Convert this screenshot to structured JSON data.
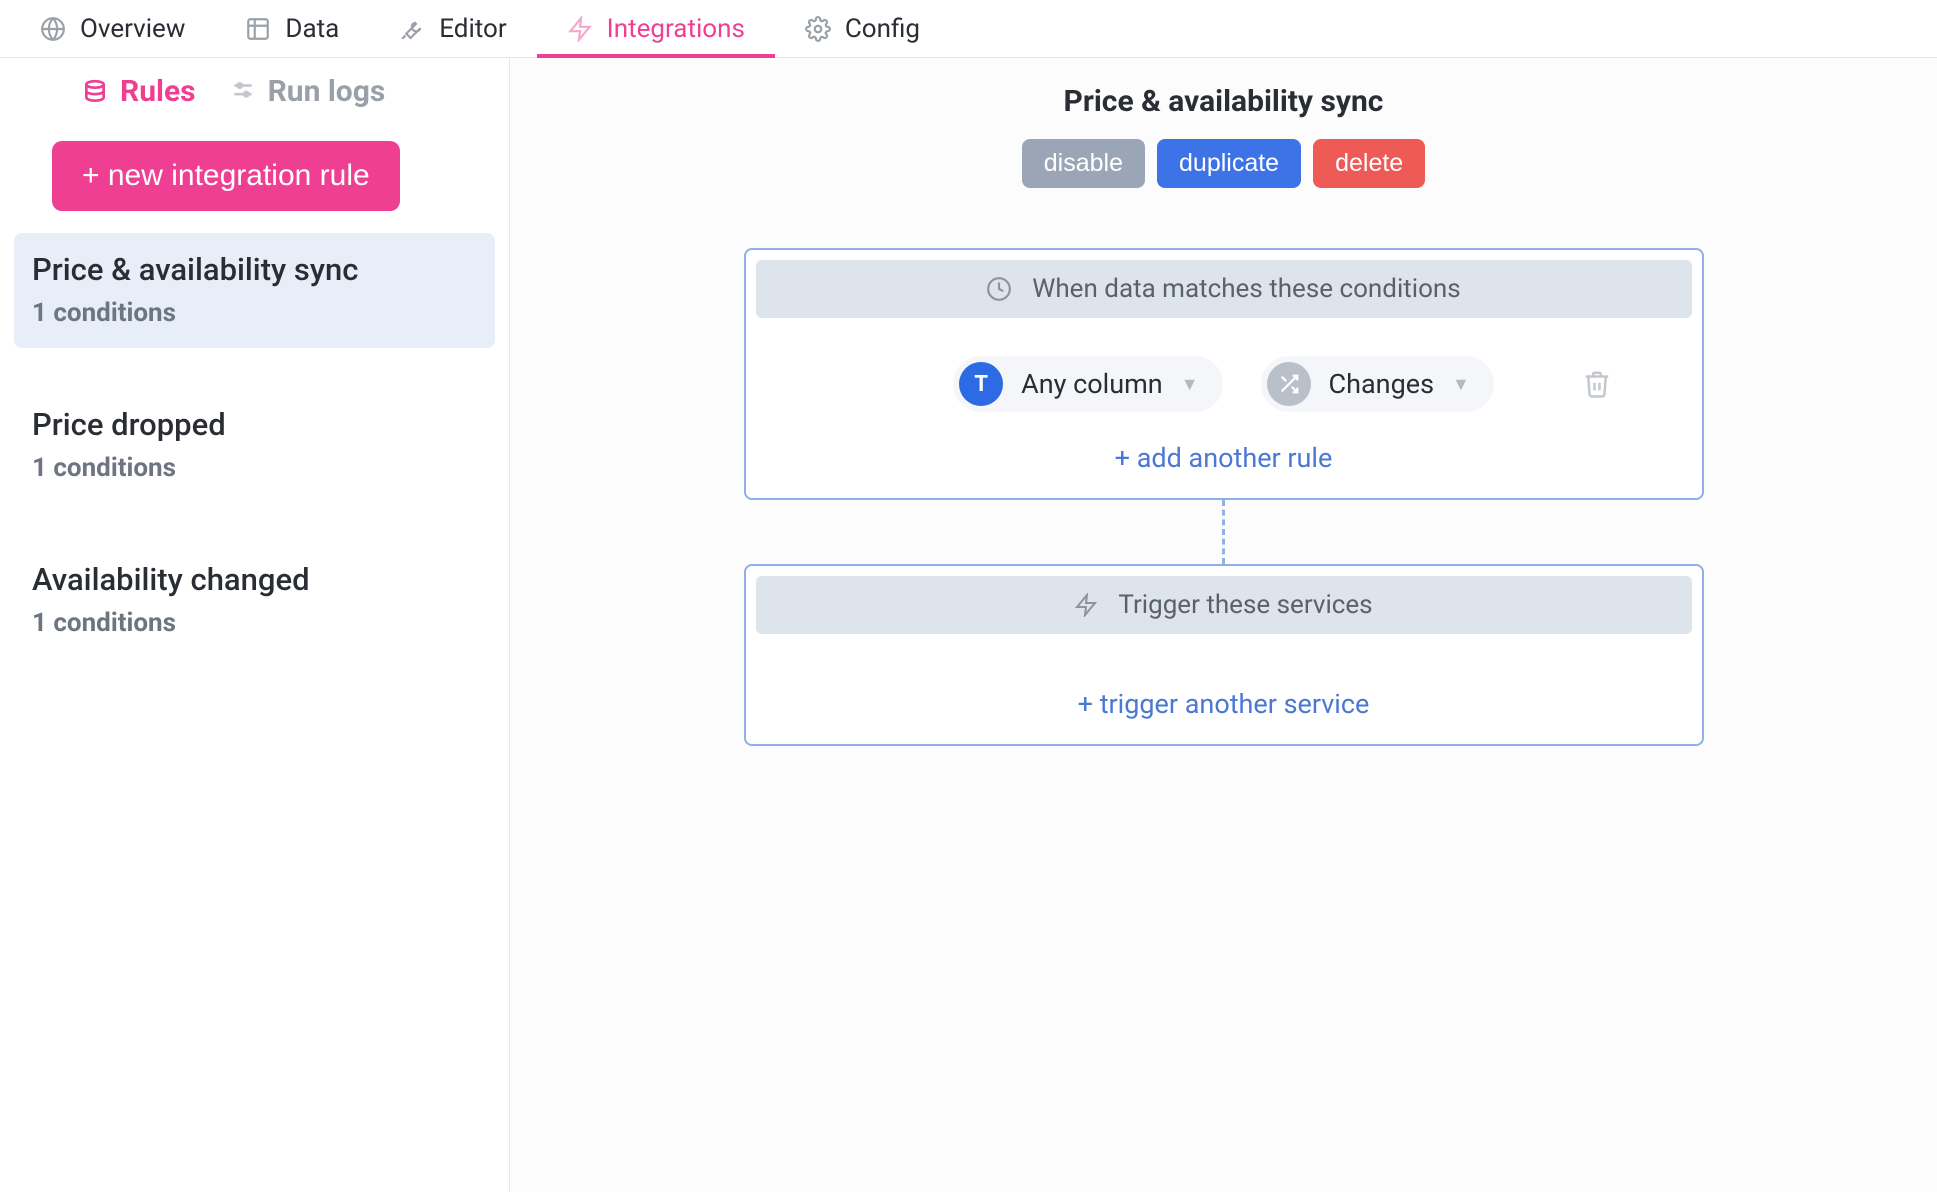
{
  "topTabs": [
    {
      "label": "Overview"
    },
    {
      "label": "Data"
    },
    {
      "label": "Editor"
    },
    {
      "label": "Integrations"
    },
    {
      "label": "Config"
    }
  ],
  "sideSubtabs": {
    "rules": "Rules",
    "runlogs": "Run logs"
  },
  "newRuleButton": "+ new integration rule",
  "rules": [
    {
      "title": "Price & availability sync",
      "sub": "1 conditions"
    },
    {
      "title": "Price dropped",
      "sub": "1 conditions"
    },
    {
      "title": "Availability changed",
      "sub": "1 conditions"
    }
  ],
  "header": {
    "title": "Price & availability sync",
    "actions": {
      "disable": "disable",
      "duplicate": "duplicate",
      "delete": "delete"
    }
  },
  "conditionsCard": {
    "header": "When data matches these conditions",
    "column": "Any column",
    "operator": "Changes",
    "addRule": "+ add another rule"
  },
  "triggersCard": {
    "header": "Trigger these services",
    "addTrigger": "+ trigger another service"
  }
}
